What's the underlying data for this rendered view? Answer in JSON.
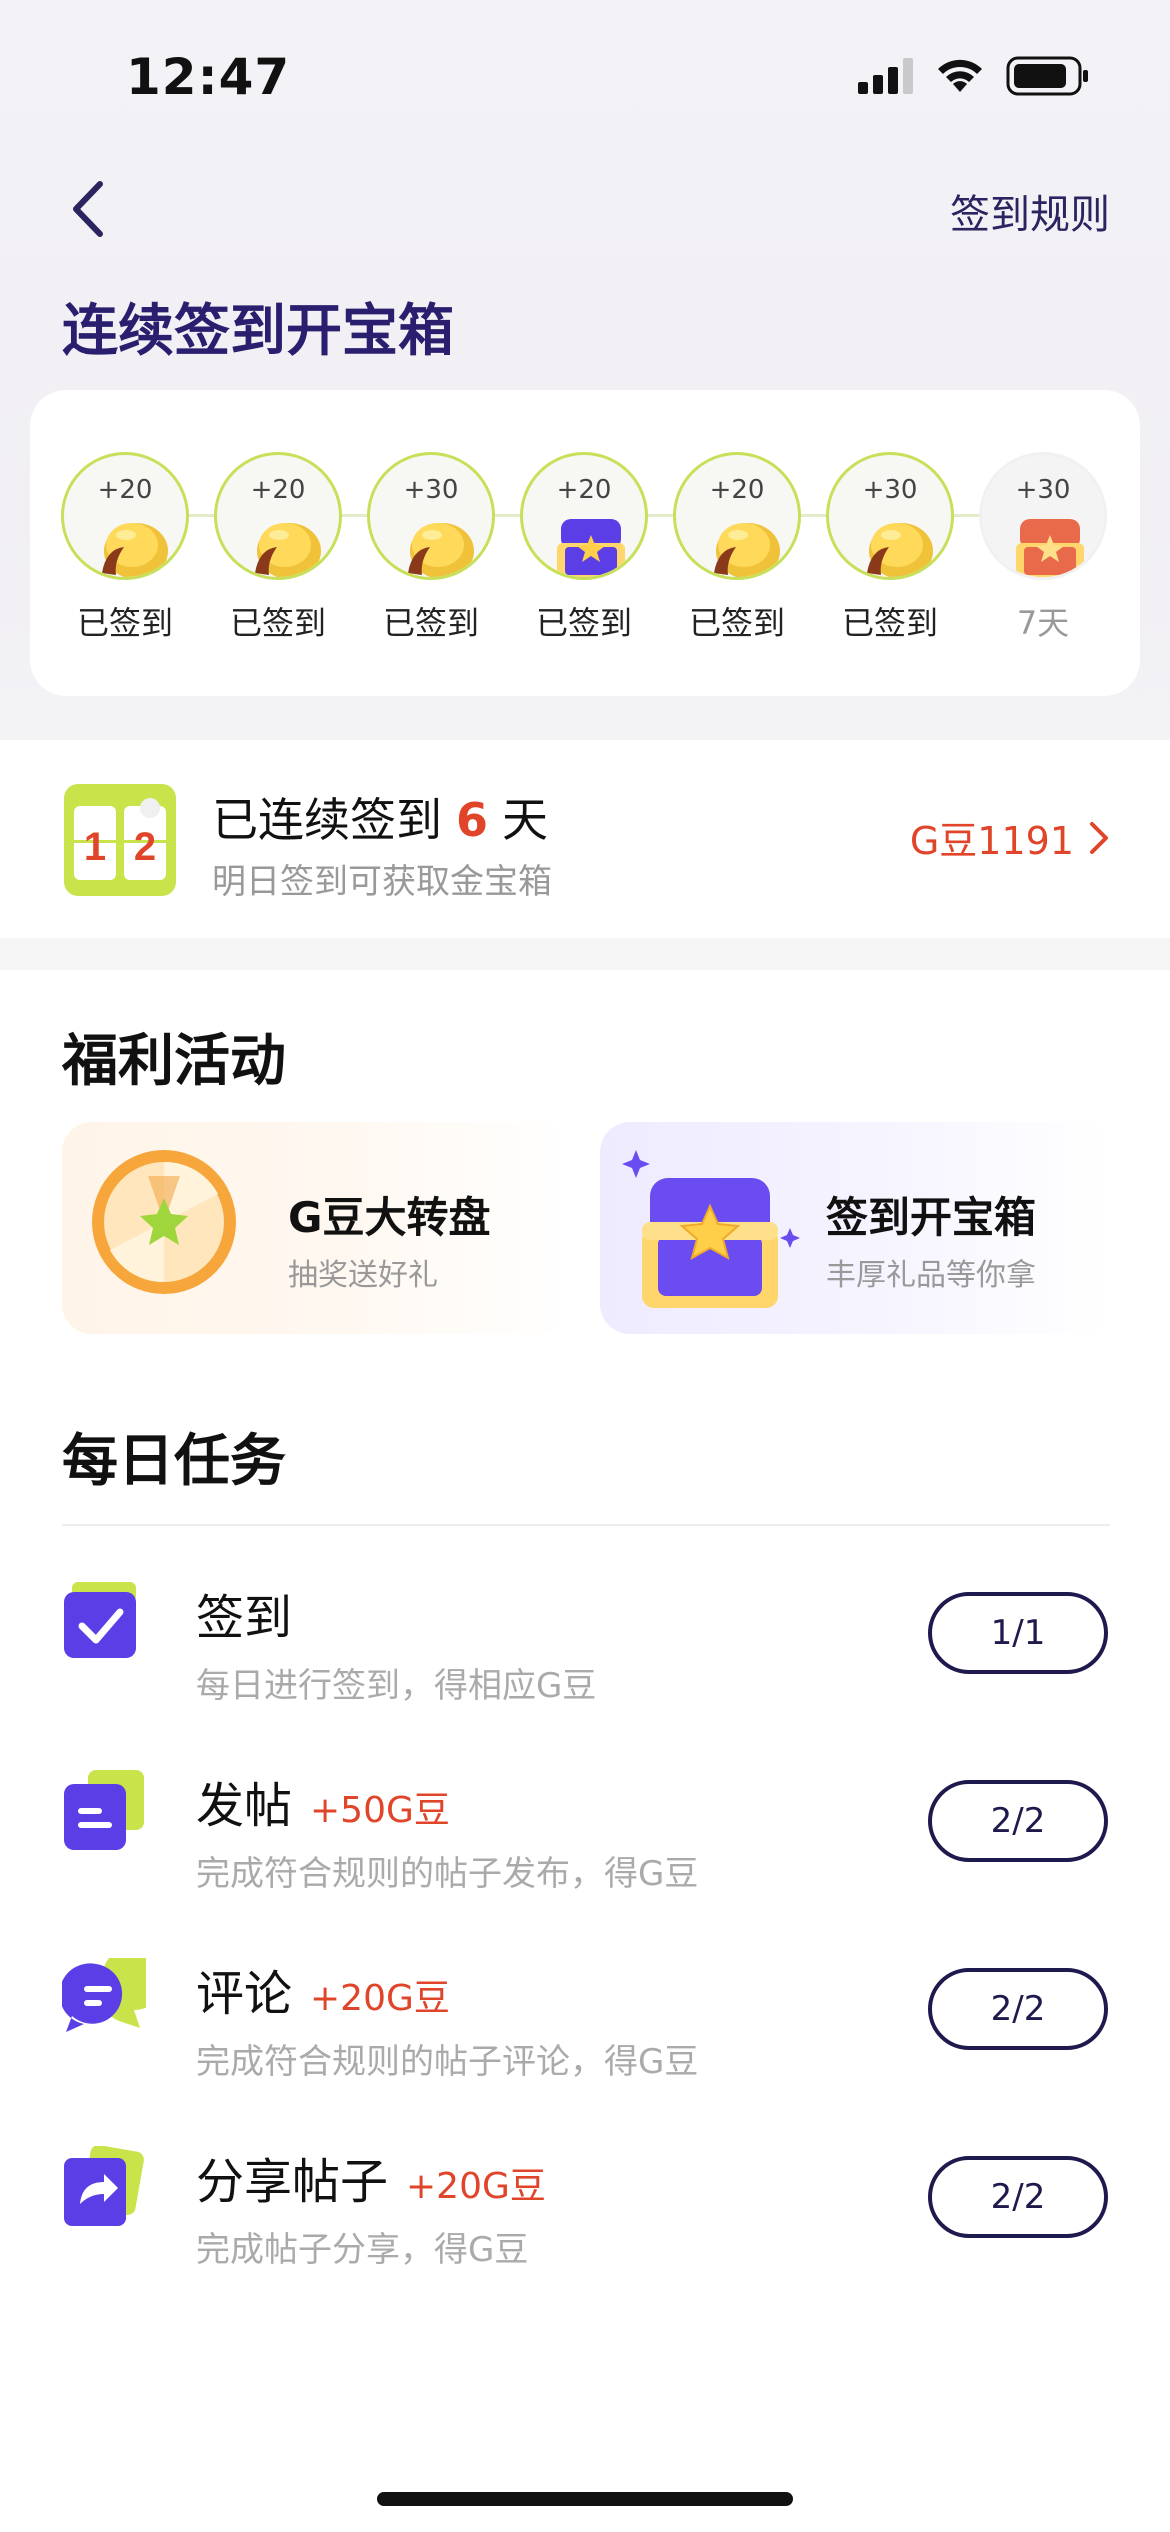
{
  "status_bar": {
    "time": "12:47"
  },
  "nav": {
    "rules_label": "签到规则"
  },
  "title": "连续签到开宝箱",
  "checkin_days": [
    {
      "points": "+20",
      "label": "已签到",
      "reward": "coin",
      "signed": true
    },
    {
      "points": "+20",
      "label": "已签到",
      "reward": "coin",
      "signed": true
    },
    {
      "points": "+30",
      "label": "已签到",
      "reward": "coin",
      "signed": true
    },
    {
      "points": "+20",
      "label": "已签到",
      "reward": "purple-chest",
      "signed": true
    },
    {
      "points": "+20",
      "label": "已签到",
      "reward": "coin",
      "signed": true
    },
    {
      "points": "+30",
      "label": "已签到",
      "reward": "coin",
      "signed": true
    },
    {
      "points": "+30",
      "label": "7天",
      "reward": "gold-chest",
      "signed": false
    }
  ],
  "streak": {
    "calendar_digits": [
      "1",
      "2"
    ],
    "prefix": "已连续签到",
    "days": "6",
    "suffix": "天",
    "subtitle": "明日签到可获取金宝箱",
    "beans_label": "G豆1191"
  },
  "welfare": {
    "title": "福利活动",
    "cards": [
      {
        "title": "G豆大转盘",
        "subtitle": "抽奖送好礼"
      },
      {
        "title": "签到开宝箱",
        "subtitle": "丰厚礼品等你拿"
      }
    ]
  },
  "daily_tasks": {
    "title": "每日任务",
    "items": [
      {
        "name": "签到",
        "bonus": "",
        "desc": "每日进行签到，得相应G豆",
        "progress": "1/1",
        "icon": "check-icon"
      },
      {
        "name": "发帖",
        "bonus": "+50G豆",
        "desc": "完成符合规则的帖子发布，得G豆",
        "progress": "2/2",
        "icon": "post-icon"
      },
      {
        "name": "评论",
        "bonus": "+20G豆",
        "desc": "完成符合规则的帖子评论，得G豆",
        "progress": "2/2",
        "icon": "comment-icon"
      },
      {
        "name": "分享帖子",
        "bonus": "+20G豆",
        "desc": "完成帖子分享，得G豆",
        "progress": "2/2",
        "icon": "share-icon"
      }
    ]
  },
  "colors": {
    "accent_red": "#e0452a",
    "title_purple": "#2a1f6e",
    "ring_green": "#c7e05a",
    "progress_navy": "#1e1a4d",
    "icon_purple": "#5b3ee6",
    "icon_lime": "#c8e44a"
  }
}
